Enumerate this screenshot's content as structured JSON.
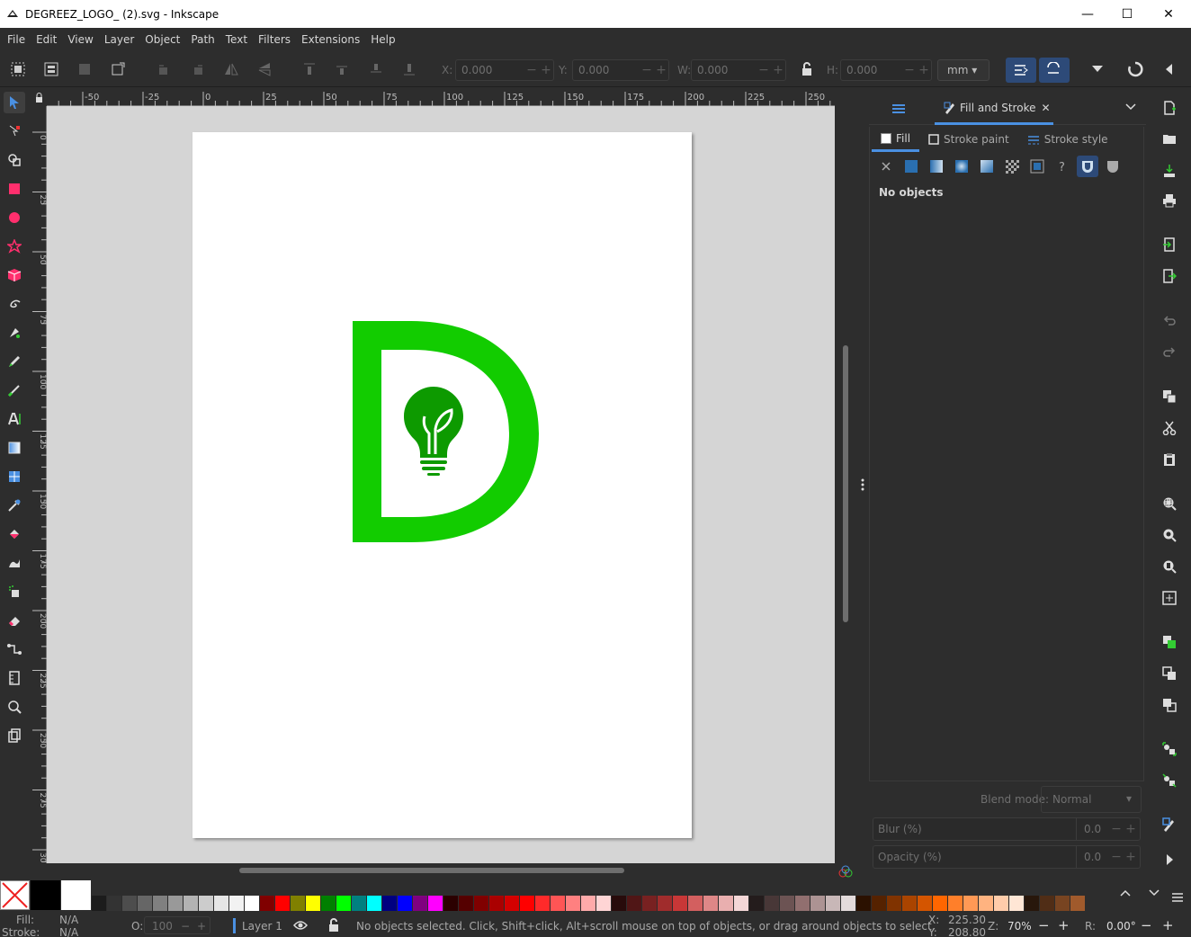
{
  "window": {
    "title": "DEGREEZ_LOGO_ (2).svg - Inkscape",
    "minimize": "—",
    "maximize": "☐",
    "close": "✕"
  },
  "menu": [
    "File",
    "Edit",
    "View",
    "Layer",
    "Object",
    "Path",
    "Text",
    "Filters",
    "Extensions",
    "Help"
  ],
  "toolbar": {
    "x_label": "X:",
    "x_value": "0.000",
    "y_label": "Y:",
    "y_value": "0.000",
    "w_label": "W:",
    "w_value": "0.000",
    "h_label": "H:",
    "h_value": "0.000",
    "unit": "mm",
    "minus": "−",
    "plus": "+"
  },
  "rulers": {
    "top": [
      "-50",
      "-25",
      "0",
      "25",
      "50",
      "75",
      "100",
      "125",
      "150",
      "175",
      "200",
      "225",
      "250"
    ],
    "left": [
      "0",
      "25",
      "50",
      "75",
      "100",
      "125",
      "150",
      "175",
      "200",
      "225",
      "250",
      "275",
      "300"
    ]
  },
  "dock": {
    "tab_label": "Fill and Stroke",
    "tab_close": "✕",
    "fill_tab": "Fill",
    "stroke_paint_tab": "Stroke paint",
    "stroke_style_tab": "Stroke style",
    "no_objects": "No objects",
    "blend_label": "Blend mode:",
    "blend_value": "Normal",
    "blur_label": "Blur (%)",
    "blur_value": "0.0",
    "opacity_label": "Opacity (%)",
    "opacity_value": "0.0"
  },
  "logo": {
    "color": "#12cc00",
    "dark_color": "#0d9a00"
  },
  "palette_colors": [
    "#1c1c1c",
    "#333333",
    "#4d4d4d",
    "#666666",
    "#808080",
    "#999999",
    "#b3b3b3",
    "#cccccc",
    "#e6e6e6",
    "#f2f2f2",
    "#ffffff",
    "#800000",
    "#ff0000",
    "#808000",
    "#ffff00",
    "#008000",
    "#00ff00",
    "#008080",
    "#00ffff",
    "#000080",
    "#0000ff",
    "#800080",
    "#ff00ff",
    "#2b0000",
    "#550000",
    "#800000",
    "#aa0000",
    "#d40000",
    "#ff0000",
    "#ff2a2a",
    "#ff5555",
    "#ff8080",
    "#ffaaaa",
    "#ffd5d5",
    "#280b0b",
    "#501616",
    "#782121",
    "#a02c2c",
    "#c83737",
    "#d35f5f",
    "#de8787",
    "#e9afaf",
    "#f4d7d7",
    "#241c1c",
    "#483737",
    "#6c5353",
    "#916f6f",
    "#ac9393",
    "#c8b7b7",
    "#e3dbdb",
    "#2b1100",
    "#552200",
    "#803300",
    "#aa4400",
    "#d45500",
    "#ff6600",
    "#ff7f2a",
    "#ff9955",
    "#ffb380",
    "#ffccaa",
    "#ffe6d5",
    "#28170b",
    "#502d16",
    "#784421",
    "#a05a2c"
  ],
  "status": {
    "fill_label": "Fill:",
    "fill_value": "N/A",
    "stroke_label": "Stroke:",
    "stroke_value": "N/A",
    "opacity_label": "O:",
    "opacity_value": "100",
    "layer": "Layer 1",
    "message": "No objects selected. Click, Shift+click, Alt+scroll mouse on top of objects, or drag around objects to select.",
    "x_label": "X:",
    "x_value": "225.30",
    "y_label": "Y:",
    "y_value": "208.80",
    "zoom_label": "Z:",
    "zoom_value": "70%",
    "rotate_label": "R:",
    "rotate_value": "0.00°"
  }
}
